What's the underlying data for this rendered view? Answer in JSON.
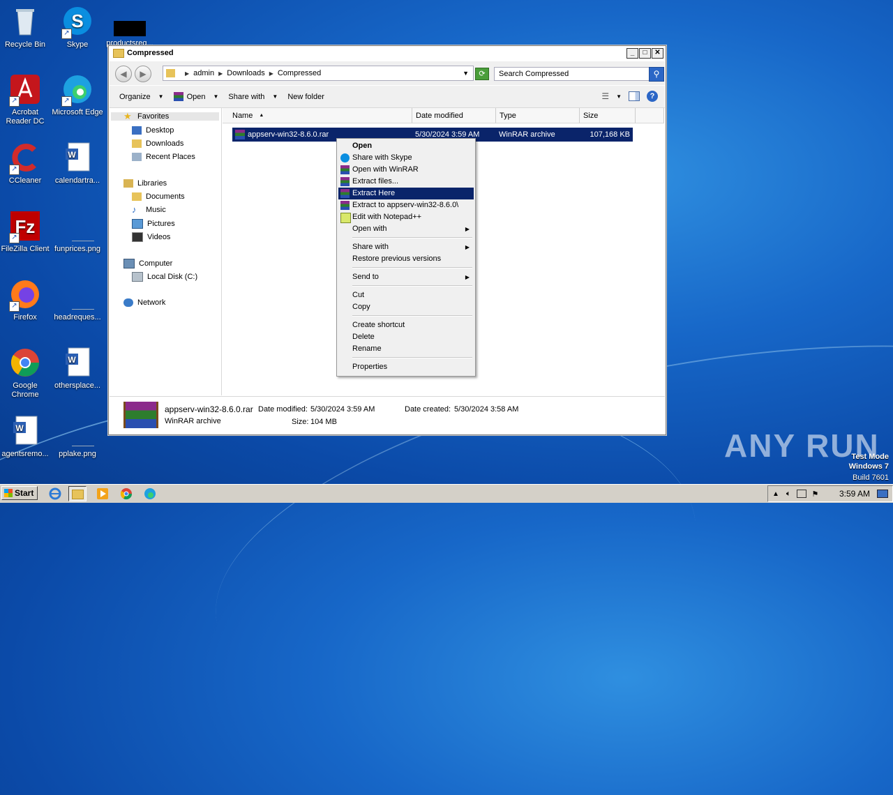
{
  "desktop": {
    "icons": [
      {
        "label": "Recycle Bin"
      },
      {
        "label": "Skype"
      },
      {
        "label": "productsreq..."
      },
      {
        "label": "Acrobat Reader DC"
      },
      {
        "label": "Microsoft Edge"
      },
      {
        "label": "CCleaner"
      },
      {
        "label": "calendartra..."
      },
      {
        "label": "FileZilla Client"
      },
      {
        "label": "funprices.png"
      },
      {
        "label": "Firefox"
      },
      {
        "label": "headreques..."
      },
      {
        "label": "Google Chrome"
      },
      {
        "label": "othersplace..."
      },
      {
        "label": "agentsremo..."
      },
      {
        "label": "pplake.png"
      }
    ],
    "watermark": "ANY RUN",
    "test_mode": [
      "Test Mode",
      "Windows 7",
      "Build 7601"
    ]
  },
  "window": {
    "title": "Compressed",
    "breadcrumb": [
      "admin",
      "Downloads",
      "Compressed"
    ],
    "search_placeholder": "Search Compressed",
    "toolbar": {
      "organize": "Organize",
      "open": "Open",
      "share_with": "Share with",
      "new_folder": "New folder"
    },
    "nav": {
      "favorites": "Favorites",
      "desktop": "Desktop",
      "downloads": "Downloads",
      "recent_places": "Recent Places",
      "libraries": "Libraries",
      "documents": "Documents",
      "music": "Music",
      "pictures": "Pictures",
      "videos": "Videos",
      "computer": "Computer",
      "local_disk": "Local Disk (C:)",
      "network": "Network"
    },
    "columns": {
      "name": "Name",
      "date_modified": "Date modified",
      "type": "Type",
      "size": "Size"
    },
    "file": {
      "name": "appserv-win32-8.6.0.rar",
      "date_modified": "5/30/2024 3:59 AM",
      "type": "WinRAR archive",
      "size": "107,168 KB"
    },
    "details": {
      "name": "appserv-win32-8.6.0.rar",
      "type": "WinRAR archive",
      "date_modified_label": "Date modified:",
      "date_modified": "5/30/2024 3:59 AM",
      "date_created_label": "Date created:",
      "date_created": "5/30/2024 3:58 AM",
      "size_label": "Size:",
      "size": "104 MB"
    }
  },
  "context_menu": {
    "open": "Open",
    "share_skype": "Share with Skype",
    "open_winrar": "Open with WinRAR",
    "extract_files": "Extract files...",
    "extract_here": "Extract Here",
    "extract_to": "Extract to appserv-win32-8.6.0\\",
    "edit_notepad": "Edit with Notepad++",
    "open_with": "Open with",
    "share_with": "Share with",
    "restore": "Restore previous versions",
    "send_to": "Send to",
    "cut": "Cut",
    "copy": "Copy",
    "create_shortcut": "Create shortcut",
    "delete": "Delete",
    "rename": "Rename",
    "properties": "Properties"
  },
  "taskbar": {
    "start": "Start",
    "clock": "3:59 AM"
  }
}
